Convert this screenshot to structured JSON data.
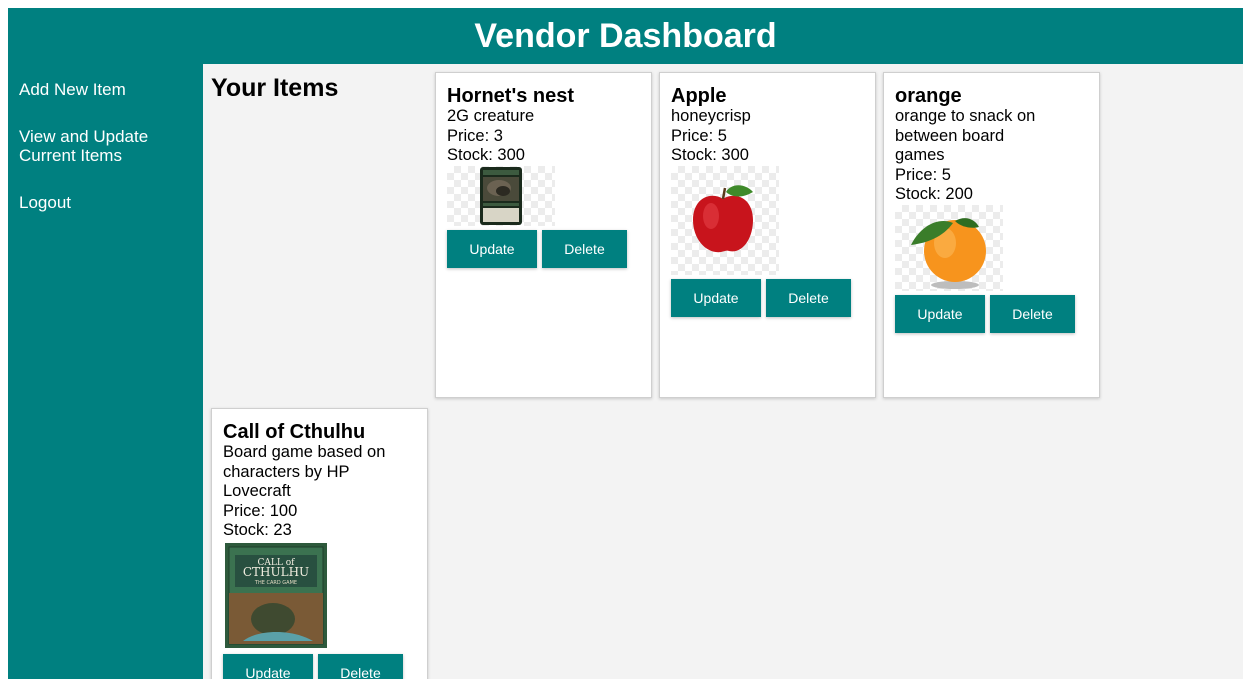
{
  "header": {
    "title": "Vendor Dashboard"
  },
  "sidebar": {
    "items": [
      {
        "label": "Add New Item"
      },
      {
        "label": "View and Update Current Items"
      },
      {
        "label": "Logout"
      }
    ]
  },
  "main": {
    "heading": "Your Items",
    "update_label": "Update",
    "delete_label": "Delete",
    "items": [
      {
        "name": "Hornet's nest",
        "description": "2G creature",
        "price": "Price: 3",
        "stock": "Stock: 300",
        "image": "mtg-card-image"
      },
      {
        "name": "Apple",
        "description": "honeycrisp",
        "price": "Price: 5",
        "stock": "Stock: 300",
        "image": "apple-image"
      },
      {
        "name": "orange",
        "description": "orange to snack on between board games",
        "price": "Price: 5",
        "stock": "Stock: 200",
        "image": "orange-image"
      },
      {
        "name": "Call of Cthulhu",
        "description": "Board game based on characters by HP Lovecraft",
        "price": "Price: 100",
        "stock": "Stock: 23",
        "image": "game-box-image",
        "image_text": [
          "CALL of",
          "CTHULHU",
          "THE CARD GAME"
        ]
      }
    ]
  },
  "colors": {
    "accent": "#008080",
    "background": "#f3f3f3"
  }
}
